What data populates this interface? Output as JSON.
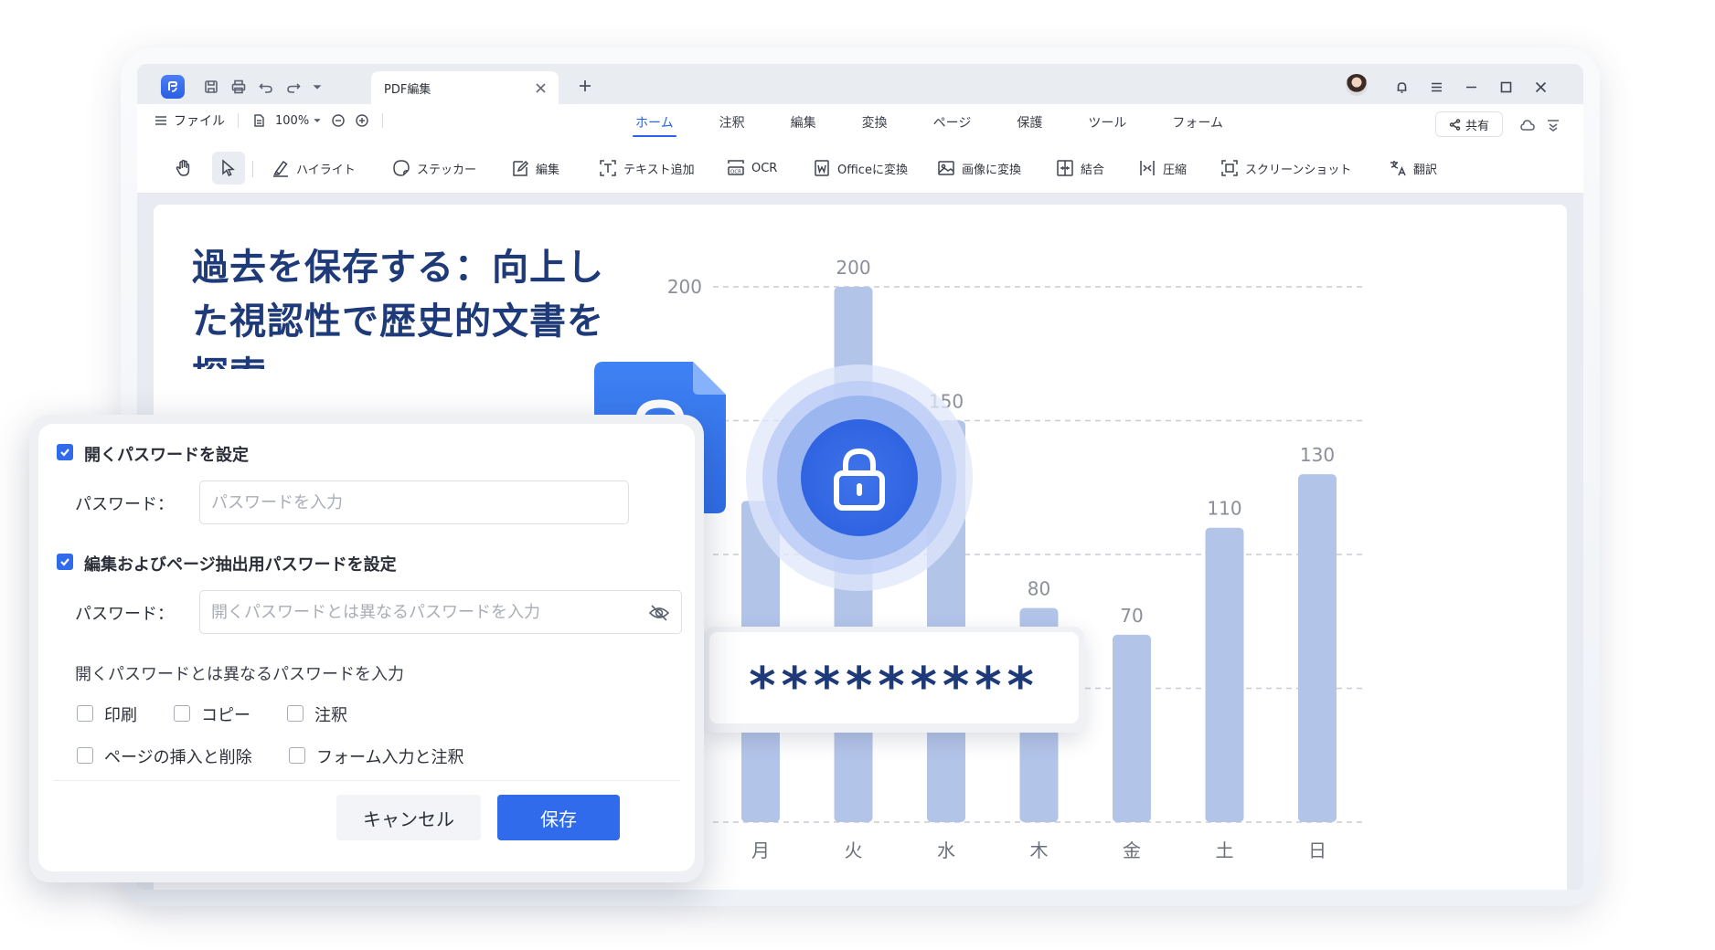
{
  "colors": {
    "accent": "#2f6bea",
    "bar": "#b3c4e9",
    "title": "#1e3a78",
    "grid": "#c9ccd3"
  },
  "titlebar": {
    "tab_label": "PDF編集",
    "icons": [
      "app-logo-icon",
      "save-icon",
      "print-icon",
      "undo-icon",
      "redo-icon",
      "dropdown-icon",
      "close-icon",
      "plus-icon",
      "avatar",
      "bell-icon",
      "menu-icon",
      "minimize-icon",
      "maximize-icon",
      "window-close-icon"
    ]
  },
  "menubar": {
    "file_label": "ファイル",
    "zoom": "100%",
    "tabs": [
      "ホーム",
      "注釈",
      "編集",
      "変換",
      "ページ",
      "保護",
      "ツール",
      "フォーム"
    ],
    "active_tab": "ホーム",
    "share_label": "共有"
  },
  "toolbar": {
    "highlight": "ハイライト",
    "sticker": "ステッカー",
    "edit": "編集",
    "add_text": "テキスト追加",
    "ocr": "OCR",
    "to_office": "Officeに変換",
    "to_image": "画像に変換",
    "combine": "結合",
    "compress": "圧縮",
    "screenshot": "スクリーンショット",
    "translate": "翻訳"
  },
  "document": {
    "title": "過去を保存する：向上した視認性で歴史的文書を探索"
  },
  "chart_data": {
    "type": "bar",
    "categories": [
      "月",
      "火",
      "水",
      "木",
      "金",
      "土",
      "日"
    ],
    "values": [
      null,
      200,
      150,
      80,
      70,
      110,
      130
    ],
    "data_labels": [
      "",
      "200",
      "150",
      "80",
      "70",
      "110",
      "130"
    ],
    "y_ticks": [
      "200"
    ],
    "ylim": [
      0,
      200
    ],
    "grid": true,
    "grid_step": 50
  },
  "password_display": "*********",
  "dialog": {
    "open_pw_label": "開くパスワードを設定",
    "open_pw_checked": true,
    "pw_field_label": "パスワード：",
    "open_pw_placeholder": "パスワードを入力",
    "edit_pw_label": "編集およびページ抽出用パスワードを設定",
    "edit_pw_checked": true,
    "edit_pw_placeholder": "開くパスワードとは異なるパスワードを入力",
    "permissions_heading": "開くパスワードとは異なるパスワードを入力",
    "permissions": [
      "印刷",
      "コピー",
      "注釈",
      "ページの挿入と削除",
      "フォーム入力と注釈"
    ],
    "cancel": "キャンセル",
    "save": "保存"
  }
}
